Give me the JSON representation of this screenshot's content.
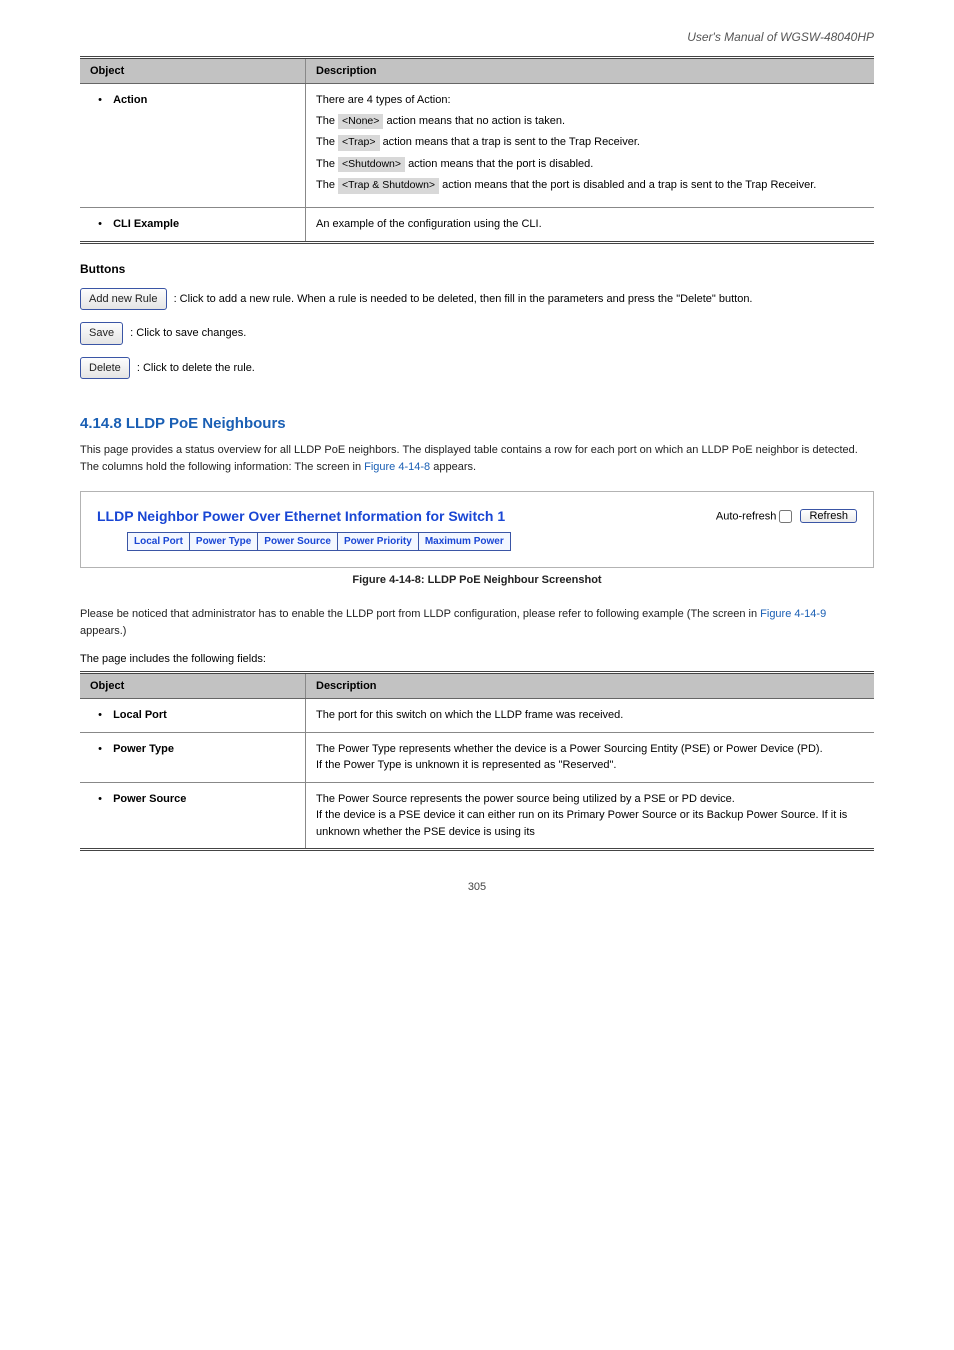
{
  "doc_title": "User's Manual of WGSW-48040HP",
  "page_number": "305",
  "table1": {
    "headers": [
      "Object",
      "Description"
    ],
    "rows": [
      {
        "object": "Action",
        "lines": [
          {
            "pre": "There are 4 types of Action:",
            "pill": null
          },
          {
            "pre": "The",
            "pill": "<None>",
            "post": "action means that no action is taken."
          },
          {
            "pre": "The",
            "pill": "<Trap>",
            "post": "action means that a trap is sent to the Trap Receiver."
          },
          {
            "pre": "The",
            "pill": "<Shutdown>",
            "post": "action means that the port is disabled."
          },
          {
            "pre": "The",
            "pill": "<Trap & Shutdown>",
            "post": "action means that the port is disabled and a trap is sent to the Trap Receiver."
          }
        ]
      },
      {
        "object": "CLI Example",
        "lines": [
          {
            "pre": "An example of the configuration using the CLI.",
            "pill": null
          }
        ]
      }
    ]
  },
  "buttons": {
    "descs": [
      {
        "label": "Add new Rule",
        "text": ": Click to add a new rule. When a rule is needed to be deleted, then fill in the parameters and press the \"Delete\" button."
      },
      {
        "label": "Save",
        "text": ": Click to save changes."
      },
      {
        "label": "Delete",
        "text": ": Click to delete the rule."
      }
    ]
  },
  "section": {
    "number": "4.14.8",
    "title": "LLDP PoE Neighbours",
    "body1": "This page provides a status overview for all LLDP PoE neighbors. The displayed table contains a row for each port on which an LLDP PoE neighbor is detected. The columns hold the following information: The screen in ",
    "body_link": "Figure 4-14-8",
    "body2": " appears."
  },
  "inset": {
    "title": "LLDP Neighbor Power Over Ethernet Information for Switch 1",
    "auto_refresh_label": "Auto-refresh",
    "refresh_label": "Refresh",
    "columns": [
      "Local Port",
      "Power Type",
      "Power Source",
      "Power Priority",
      "Maximum Power"
    ]
  },
  "figure_caption": "Figure 4-14-8: LLDP PoE Neighbour Screenshot",
  "note_line": "Please be noticed that administrator has to enable the LLDP port from LLDP configuration, please refer to following example (The screen in ",
  "note_link": "Figure 4-14-9",
  "note_line_end": " appears.)",
  "table2_lead": "The page includes the following fields:",
  "table2": {
    "headers": [
      "Object",
      "Description"
    ],
    "rows": [
      {
        "object": "Local Port",
        "desc": "The port for this switch on which the LLDP frame was received."
      },
      {
        "object": "Power Type",
        "desc": "The Power Type represents whether the device is a Power Sourcing Entity (PSE) or Power Device (PD).\nIf the Power Type is unknown it is represented as \"Reserved\"."
      },
      {
        "object": "Power Source",
        "desc": "The Power Source represents the power source being utilized by a PSE or PD device.\nIf the device is a PSE device it can either run on its Primary Power Source or its Backup Power Source. If it is unknown whether the PSE device is using its"
      }
    ]
  }
}
